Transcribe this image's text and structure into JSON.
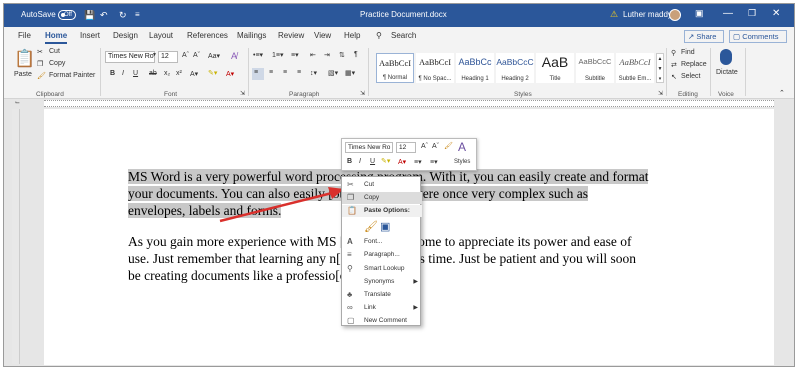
{
  "titlebar": {
    "autosave": "AutoSave",
    "autosave_state": "Off",
    "document_title": "Practice Document.docx",
    "user": "Luther maddy"
  },
  "menu": [
    "File",
    "Home",
    "Insert",
    "Design",
    "Layout",
    "References",
    "Mailings",
    "Review",
    "View",
    "Help"
  ],
  "search": "Search",
  "share": "Share",
  "comments": "Comments",
  "clipboard": {
    "paste": "Paste",
    "cut": "Cut",
    "copy": "Copy",
    "format_painter": "Format Painter",
    "group": "Clipboard"
  },
  "font": {
    "name": "Times New Ro",
    "size": "12",
    "group": "Font"
  },
  "paragraph": {
    "group": "Paragraph"
  },
  "styles": {
    "group": "Styles",
    "items": [
      {
        "sample": "AaBbCcI",
        "name": "¶ Normal"
      },
      {
        "sample": "AaBbCcI",
        "name": "¶ No Spac..."
      },
      {
        "sample": "AaBbCc",
        "name": "Heading 1"
      },
      {
        "sample": "AaBbCcC",
        "name": "Heading 2"
      },
      {
        "sample": "AaB",
        "name": "Title"
      },
      {
        "sample": "AaBbCcC",
        "name": "Subtitle"
      },
      {
        "sample": "AaBbCcI",
        "name": "Subtle Em..."
      }
    ]
  },
  "editing": {
    "find": "Find",
    "replace": "Replace",
    "select": "Select",
    "group": "Editing"
  },
  "voice": {
    "dictate": "Dictate",
    "group": "Voice"
  },
  "document": {
    "para1": [
      "MS Word is a very powerful word processing program.  With it, you can easily create and format",
      "your documents.  You can also easily [obscured] that were once very complex such as",
      "envelopes, labels and forms."
    ],
    "para2": [
      "As you gain more experience with MS [obscured]ill come to appreciate its power and ease of",
      "use.  Just remember that learning any n[obscured] takes time.  Just be patient and you will soon",
      "be creating documents like a professio[obscured]ssor."
    ]
  },
  "minitoolbar": {
    "font": "Times New Ro",
    "size": "12",
    "styles": "Styles"
  },
  "context_menu": {
    "items": [
      "Cut",
      "Copy",
      "Paste Options:",
      "Font...",
      "Paragraph...",
      "Smart Lookup",
      "Synonyms",
      "Translate",
      "Link",
      "New Comment"
    ]
  },
  "colors": {
    "brand": "#2b579a",
    "highlight": "#c8c8c8",
    "arrow": "#d9302c"
  }
}
